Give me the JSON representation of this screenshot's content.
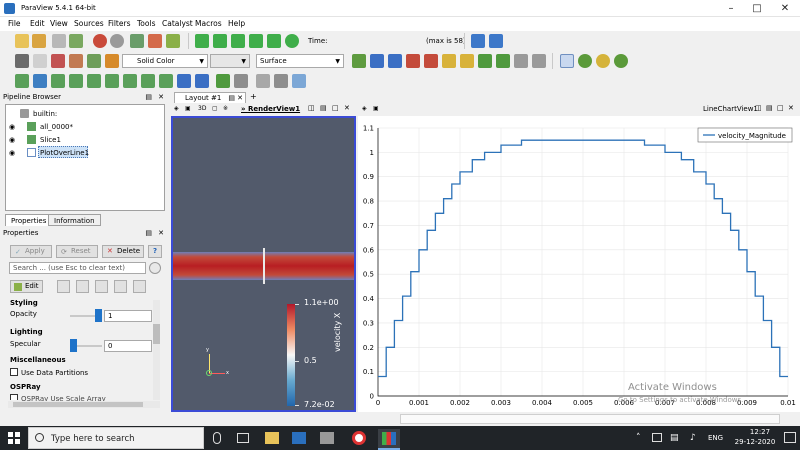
{
  "window": {
    "title": "ParaView 5.4.1 64-bit"
  },
  "menu": [
    "File",
    "Edit",
    "View",
    "Sources",
    "Filters",
    "Tools",
    "Catalyst",
    "Macros",
    "Help"
  ],
  "time": {
    "label": "Time:",
    "value": "58",
    "step": "58",
    "max_label": "(max is 58)"
  },
  "display": {
    "color_mode": "Solid Color",
    "representation": "Surface"
  },
  "pipeline": {
    "title": "Pipeline Browser",
    "items": [
      {
        "label": "builtin:"
      },
      {
        "label": "all_0000*"
      },
      {
        "label": "Slice1"
      },
      {
        "label": "PlotOverLine1"
      }
    ]
  },
  "tabs": {
    "properties": "Properties",
    "information": "Information"
  },
  "properties": {
    "title": "Properties",
    "apply": "Apply",
    "reset": "Reset",
    "delete": "Delete",
    "help": "?",
    "search_placeholder": "Search ... (use Esc to clear text)",
    "edit": "Edit",
    "styling": "Styling",
    "opacity_label": "Opacity",
    "opacity_value": "1",
    "opacity_fraction": 1,
    "lighting": "Lighting",
    "specular_label": "Specular",
    "specular_value": "0",
    "specular_fraction": 0,
    "misc": "Miscellaneous",
    "data_partitions": "Use Data Partitions",
    "ospray": "OSPRay",
    "ospray_item": "OSPRay Use Scale Array"
  },
  "layout": {
    "tab": "Layout #1",
    "add": "+",
    "render_view": "RenderView1",
    "mode_3d": "3D",
    "chart_view": "LineChartView1"
  },
  "colorbar": {
    "max": "1.1e+00",
    "mid": "0.5",
    "min": "7.2e-02",
    "title": "velocity X"
  },
  "axes_labels": {
    "x": "x",
    "y": "y"
  },
  "chart_data": {
    "type": "line",
    "x_ticks": [
      "0",
      "0.001",
      "0.002",
      "0.003",
      "0.004",
      "0.005",
      "0.006",
      "0.007",
      "0.008",
      "0.009",
      "0.01"
    ],
    "y_ticks": [
      "0",
      "0.1",
      "0.2",
      "0.3",
      "0.4",
      "0.5",
      "0.6",
      "0.7",
      "0.8",
      "0.9",
      "1",
      "1.1"
    ],
    "xlim": [
      0,
      0.01
    ],
    "ylim": [
      0,
      1.1
    ],
    "grid": true,
    "legend_position": "top-right",
    "series": [
      {
        "name": "velocity_Magnitude",
        "color": "#2c72b8",
        "x": [
          0,
          0.0002,
          0.0002,
          0.0004,
          0.0004,
          0.0006,
          0.0006,
          0.0008,
          0.0008,
          0.001,
          0.001,
          0.0012,
          0.0012,
          0.0014,
          0.0014,
          0.0016,
          0.0016,
          0.0018,
          0.0018,
          0.002,
          0.002,
          0.0023,
          0.0023,
          0.0026,
          0.0026,
          0.003,
          0.003,
          0.0035,
          0.0035,
          0.0065,
          0.0065,
          0.007,
          0.007,
          0.0074,
          0.0074,
          0.0077,
          0.0077,
          0.008,
          0.008,
          0.0082,
          0.0082,
          0.0084,
          0.0084,
          0.0086,
          0.0086,
          0.0088,
          0.0088,
          0.009,
          0.009,
          0.0092,
          0.0092,
          0.0094,
          0.0094,
          0.0096,
          0.0096,
          0.0098,
          0.0098,
          0.01
        ],
        "y": [
          0.08,
          0.08,
          0.2,
          0.2,
          0.31,
          0.31,
          0.41,
          0.41,
          0.51,
          0.51,
          0.6,
          0.6,
          0.68,
          0.68,
          0.75,
          0.75,
          0.81,
          0.81,
          0.87,
          0.87,
          0.92,
          0.92,
          0.97,
          0.97,
          1.0,
          1.0,
          1.03,
          1.03,
          1.05,
          1.05,
          1.03,
          1.03,
          1.0,
          1.0,
          0.97,
          0.97,
          0.92,
          0.92,
          0.87,
          0.87,
          0.81,
          0.81,
          0.75,
          0.75,
          0.68,
          0.68,
          0.6,
          0.6,
          0.51,
          0.51,
          0.41,
          0.41,
          0.31,
          0.31,
          0.2,
          0.2,
          0.08,
          0.08
        ]
      }
    ]
  },
  "watermark": {
    "line1": "Activate Windows",
    "line2": "Go to Settings to activate Windows."
  },
  "taskbar": {
    "search": "Type here to search",
    "lang": "ENG",
    "time": "12:27",
    "date": "29-12-2020"
  }
}
